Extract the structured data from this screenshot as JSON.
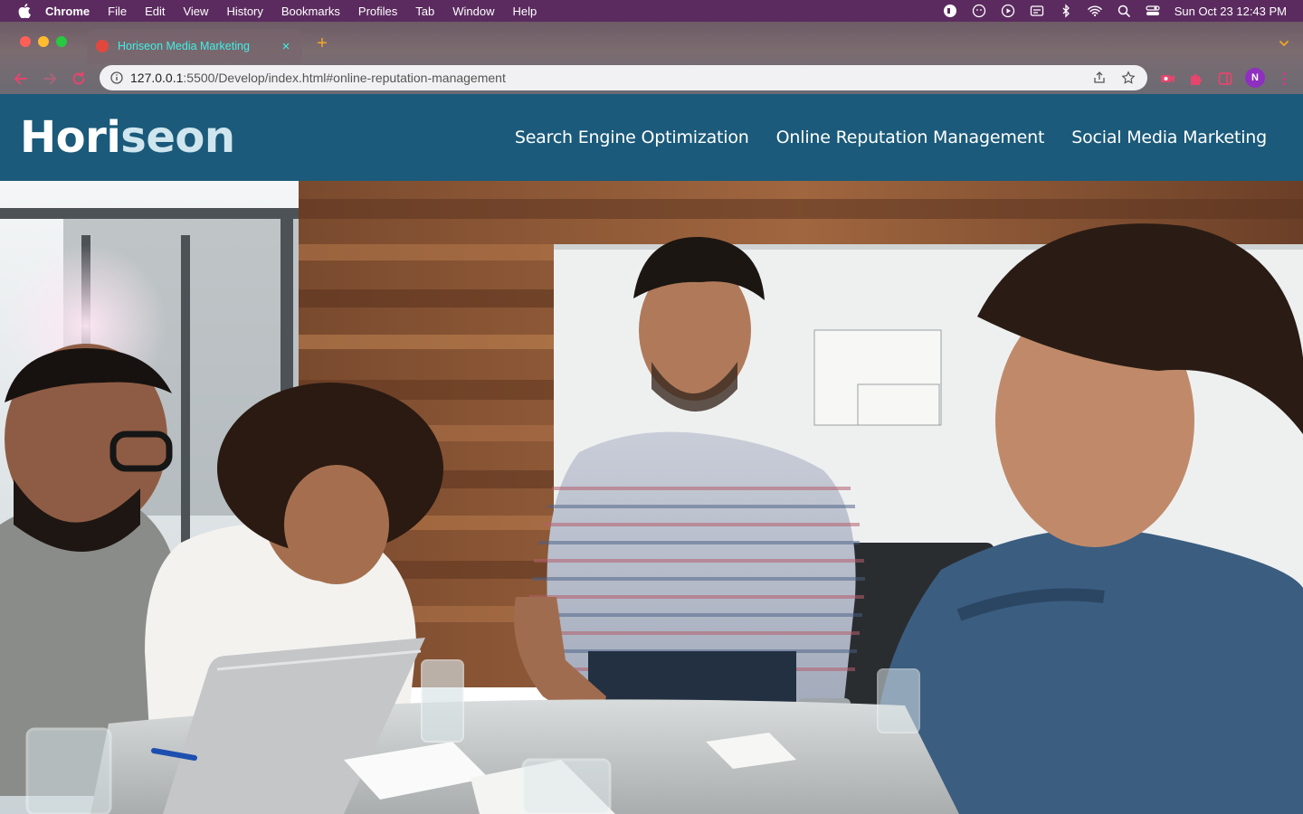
{
  "menubar": {
    "app_name": "Chrome",
    "items": [
      "File",
      "Edit",
      "View",
      "History",
      "Bookmarks",
      "Profiles",
      "Tab",
      "Window",
      "Help"
    ],
    "clock": "Sun Oct 23  12:43 PM"
  },
  "browser": {
    "tab_title": "Horiseon Media Marketing",
    "close_glyph": "×",
    "newtab_glyph": "+",
    "url_host": "127.0.0.1",
    "url_path": ":5500/Develop/index.html#online-reputation-management",
    "profile_initial": "N"
  },
  "site": {
    "logo_main": "Hori",
    "logo_accent": "seon",
    "nav": [
      "Search Engine Optimization",
      "Online Reputation Management",
      "Social Media Marketing"
    ]
  },
  "colors": {
    "header_bg": "#1b5a7a",
    "menubar_bg": "#5b2b5f",
    "tab_title": "#3ef0e6"
  }
}
